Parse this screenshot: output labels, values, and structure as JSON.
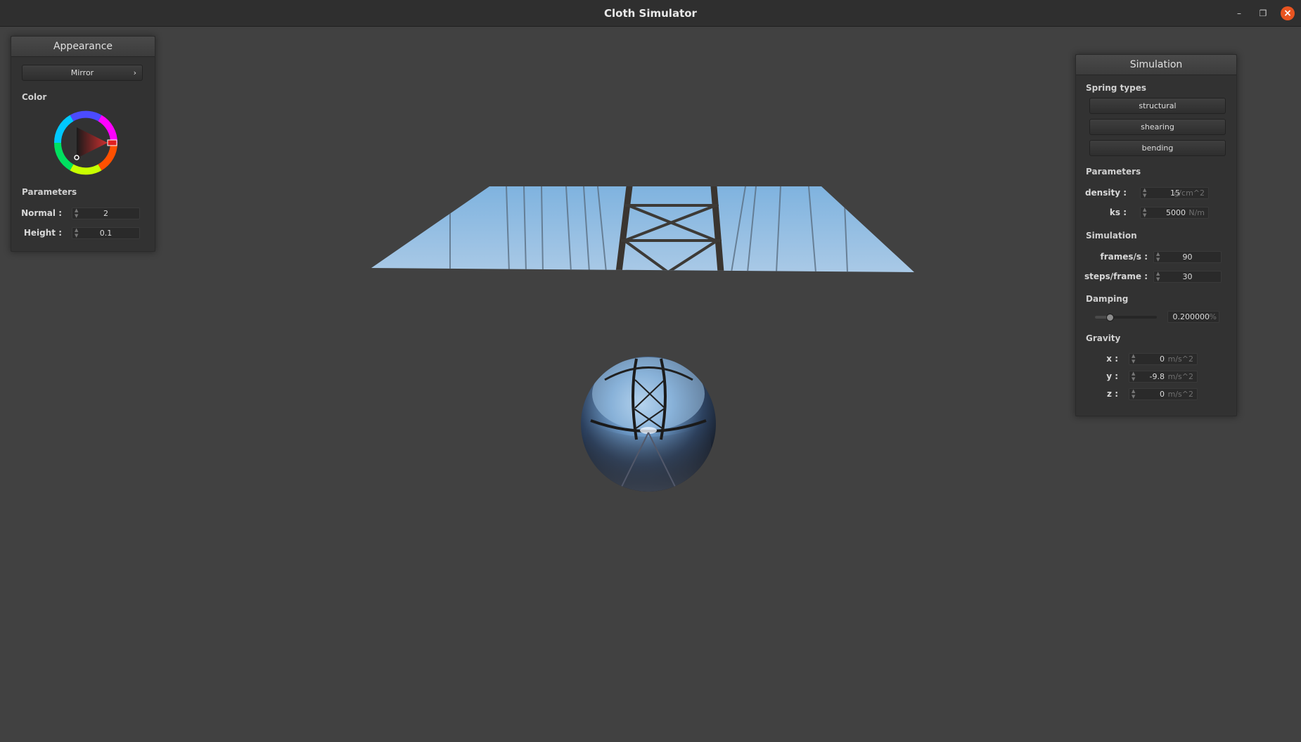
{
  "window": {
    "title": "Cloth Simulator"
  },
  "appearance": {
    "header": "Appearance",
    "material": "Mirror",
    "color_label": "Color",
    "selected_color": "#c43a3a",
    "parameters_label": "Parameters",
    "normal": {
      "label": "Normal :",
      "value": "2"
    },
    "height": {
      "label": "Height :",
      "value": "0.1"
    }
  },
  "simulation": {
    "header": "Simulation",
    "spring_types_label": "Spring types",
    "spring_types": [
      "structural",
      "shearing",
      "bending"
    ],
    "parameters_label": "Parameters",
    "density": {
      "label": "density :",
      "value": "15",
      "unit": "g/cm^2"
    },
    "ks": {
      "label": "ks :",
      "value": "5000",
      "unit": "N/m"
    },
    "simulation_label": "Simulation",
    "frames": {
      "label": "frames/s :",
      "value": "90"
    },
    "steps": {
      "label": "steps/frame :",
      "value": "30"
    },
    "damping_label": "Damping",
    "damping": {
      "value": "0.200000",
      "unit": "%",
      "slider_fraction": 0.2
    },
    "gravity_label": "Gravity",
    "gravity": {
      "x": {
        "label": "x :",
        "value": "0",
        "unit": "m/s^2"
      },
      "y": {
        "label": "y :",
        "value": "-9.8",
        "unit": "m/s^2"
      },
      "z": {
        "label": "z :",
        "value": "0",
        "unit": "m/s^2"
      }
    }
  }
}
